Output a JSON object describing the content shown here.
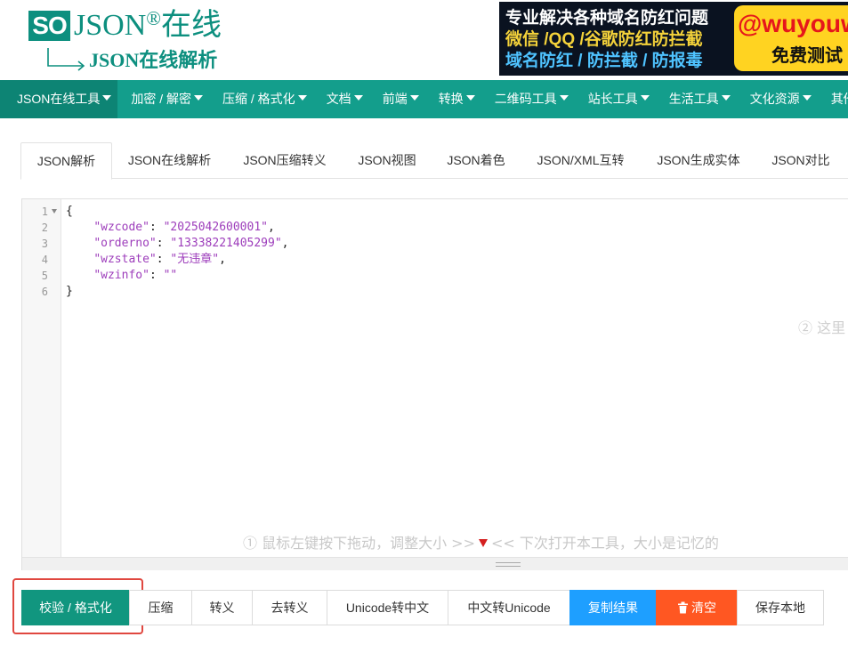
{
  "header": {
    "logo_badge": "SO",
    "logo_title": "JSON",
    "logo_reg": "®",
    "logo_suffix": "在线",
    "logo_subtitle": "JSON在线解析",
    "ad": {
      "line1": "专业解决各种域名防红问题",
      "line2": "微信 /QQ /谷歌防红防拦截",
      "line3": "域名防红 / 防拦截 / 防报毒",
      "brand": "@wuyouwa",
      "free": "免费测试"
    }
  },
  "nav": {
    "items": [
      {
        "label": "JSON在线工具"
      },
      {
        "label": "加密 / 解密"
      },
      {
        "label": "压缩 / 格式化"
      },
      {
        "label": "文档"
      },
      {
        "label": "前端"
      },
      {
        "label": "转换"
      },
      {
        "label": "二维码工具"
      },
      {
        "label": "站长工具"
      },
      {
        "label": "生活工具"
      },
      {
        "label": "文化资源"
      },
      {
        "label": "其他"
      }
    ]
  },
  "tabs": [
    {
      "label": "JSON解析"
    },
    {
      "label": "JSON在线解析"
    },
    {
      "label": "JSON压缩转义"
    },
    {
      "label": "JSON视图"
    },
    {
      "label": "JSON着色"
    },
    {
      "label": "JSON/XML互转"
    },
    {
      "label": "JSON生成实体"
    },
    {
      "label": "JSON对比"
    }
  ],
  "editor": {
    "line_numbers": [
      "1",
      "2",
      "3",
      "4",
      "5",
      "6"
    ],
    "lines": [
      {
        "open": "{"
      },
      {
        "key": "\"wzcode\"",
        "value": "\"2025042600001\"",
        "comma": ","
      },
      {
        "key": "\"orderno\"",
        "value": "\"13338221405299\"",
        "comma": ","
      },
      {
        "key": "\"wzstate\"",
        "value": "\"无违章\"",
        "comma": ","
      },
      {
        "key": "\"wzinfo\"",
        "value": "\"\"",
        "comma": ""
      },
      {
        "close": "}"
      }
    ],
    "hint_right": "② 这里",
    "hint_bottom_left": "① 鼠标左键按下拖动，调整大小 >>",
    "hint_bottom_right": "<< 下次打开本工具，大小是记忆的"
  },
  "toolbar": {
    "validate_format": "校验 / 格式化",
    "compress": "压缩",
    "escape": "转义",
    "unescape": "去转义",
    "unicode_to_cn": "Unicode转中文",
    "cn_to_unicode": "中文转Unicode",
    "copy_result": "复制结果",
    "clear": "清空",
    "save_local": "保存本地"
  },
  "colors": {
    "brand": "#0d8f7f",
    "nav_bg": "#139e8c",
    "primary_button": "#11967f",
    "copy_button": "#1e9fff",
    "clear_button": "#ff5722",
    "highlight_box": "#e0473f"
  }
}
